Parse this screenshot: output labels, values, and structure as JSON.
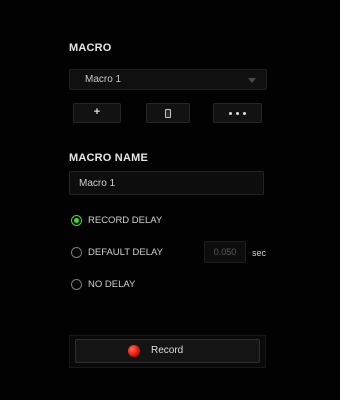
{
  "macro_section": {
    "heading": "MACRO",
    "selected_macro": "Macro 1",
    "add_glyph": "+"
  },
  "macro_name_section": {
    "heading": "MACRO NAME",
    "value": "Macro 1"
  },
  "delay_options": {
    "record_delay": "RECORD DELAY",
    "default_delay": "DEFAULT DELAY",
    "no_delay": "NO DELAY",
    "selected": "record_delay",
    "default_delay_value": "0.050",
    "unit": "sec"
  },
  "record_button": {
    "label": "Record"
  },
  "colors": {
    "background": "#020202",
    "accent_green": "#44d62c",
    "record_red": "#e01a0a"
  }
}
